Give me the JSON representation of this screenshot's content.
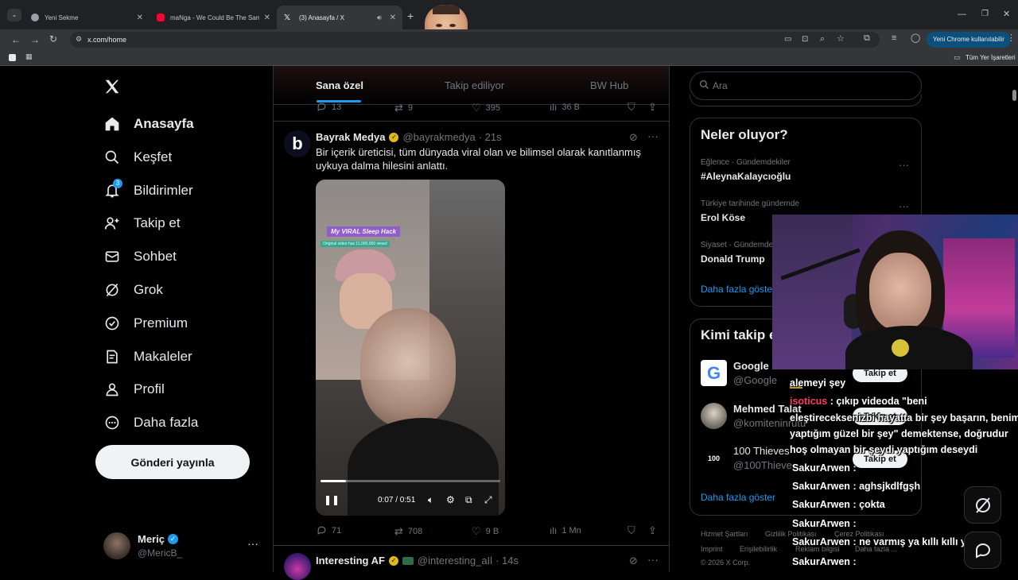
{
  "browser": {
    "tabs": [
      {
        "title": "Yeni Sekme",
        "favicon": "chrome-icon"
      },
      {
        "title": "maNga - We Could Be The Sam",
        "favicon": "youtube-icon"
      },
      {
        "title": "(3) Anasayfa / X",
        "favicon": "x-icon"
      }
    ],
    "url": "x.com/home",
    "profile_label": "Yeni Chrome kullanılabilir",
    "bookmarks_all": "Tüm Yer İşaretleri"
  },
  "nav": {
    "items": [
      {
        "label": "Anasayfa",
        "icon": "home-icon"
      },
      {
        "label": "Keşfet",
        "icon": "search-icon"
      },
      {
        "label": "Bildirimler",
        "icon": "bell-icon",
        "badge": "3"
      },
      {
        "label": "Takip et",
        "icon": "follow-icon"
      },
      {
        "label": "Sohbet",
        "icon": "mail-icon"
      },
      {
        "label": "Grok",
        "icon": "grok-icon"
      },
      {
        "label": "Premium",
        "icon": "verified-icon"
      },
      {
        "label": "Makaleler",
        "icon": "articles-icon"
      },
      {
        "label": "Profil",
        "icon": "profile-icon"
      },
      {
        "label": "Daha fazla",
        "icon": "more-circle-icon"
      }
    ],
    "post_button": "Gönderi yayınla",
    "account": {
      "name": "Meriç",
      "handle": "@MericB_"
    }
  },
  "timeline": {
    "tabs": [
      "Sana özel",
      "Takip ediliyor",
      "BW Hub"
    ],
    "prev_actions": {
      "replies": "13",
      "reposts": "9",
      "likes": "395",
      "views": "36 B"
    },
    "tweet": {
      "name": "Bayrak Medya",
      "handle": "@bayrakmedya",
      "time": "· 21s",
      "text": "Bir içerik üreticisi, tüm dünyada viral olan ve bilimsel olarak kanıtlanmış uykuya dalma hilesini anlattı.",
      "video_time": "0:07 / 0:51",
      "video_progress": 0.14,
      "overlay_title": "My VIRAL Sleep Hack",
      "overlay_sub": "Original video has 11,000,000 views!",
      "replies": "71",
      "reposts": "708",
      "likes": "9 B",
      "views": "1 Mn"
    },
    "next_tweet": {
      "name": "Interesting AF",
      "handle": "@interesting_aIl",
      "time": "· 14s"
    }
  },
  "right": {
    "search_placeholder": "Ara",
    "trends_title": "Neler oluyor?",
    "trends": [
      {
        "category": "Eğlence · Gündemdekiler",
        "name": "#AleynaKalaycıoğlu"
      },
      {
        "category": "Türkiye tarihinde gündemde",
        "name": "Erol Köse"
      },
      {
        "category": "Siyaset · Gündemde",
        "name": "Donald Trump"
      }
    ],
    "show_more": "Daha fazla göster",
    "who_title": "Kimi takip et",
    "who": [
      {
        "name": "Google",
        "handle": "@Google"
      },
      {
        "name": "Mehmed Talat",
        "handle": "@komiteninrutu"
      },
      {
        "name": "100 Thieves",
        "handle": "@100Thieves"
      }
    ],
    "follow_label": "Takip et",
    "show_more2": "Daha fazla göster",
    "footer": [
      "Hizmet Şartları",
      "Gizlilik Politikası",
      "Çerez Politikası",
      "Imprint",
      "Erişilebilirlik",
      "Reklam bilgisi",
      "Daha fazla ...",
      "© 2026 X Corp."
    ]
  },
  "chat": [
    {
      "user": "",
      "text": "alemeyi şey"
    },
    {
      "user": "isoticus",
      "text": ": çıkıp videoda \"beni"
    },
    {
      "user": "",
      "text": "eleştireceksenizbi hayatta bir şey başarın, benim"
    },
    {
      "user": "",
      "text": "yaptığım güzel bir şey\" demektense, doğrudur"
    },
    {
      "user": "",
      "text": "hoş olmayan bir şeydi yaptığım deseydi"
    },
    {
      "user": "SakurArwen",
      "text": ":"
    },
    {
      "user": "SakurArwen",
      "text": ": aghsjkdlfgşh"
    },
    {
      "user": "SakurArwen",
      "text": ": çokta"
    },
    {
      "user": "SakurArwen",
      "text": ":"
    },
    {
      "user": "SakurArwen",
      "text": ": ne varmış ya kıllı kıllı ye geç"
    },
    {
      "user": "SakurArwen",
      "text": ":"
    }
  ]
}
